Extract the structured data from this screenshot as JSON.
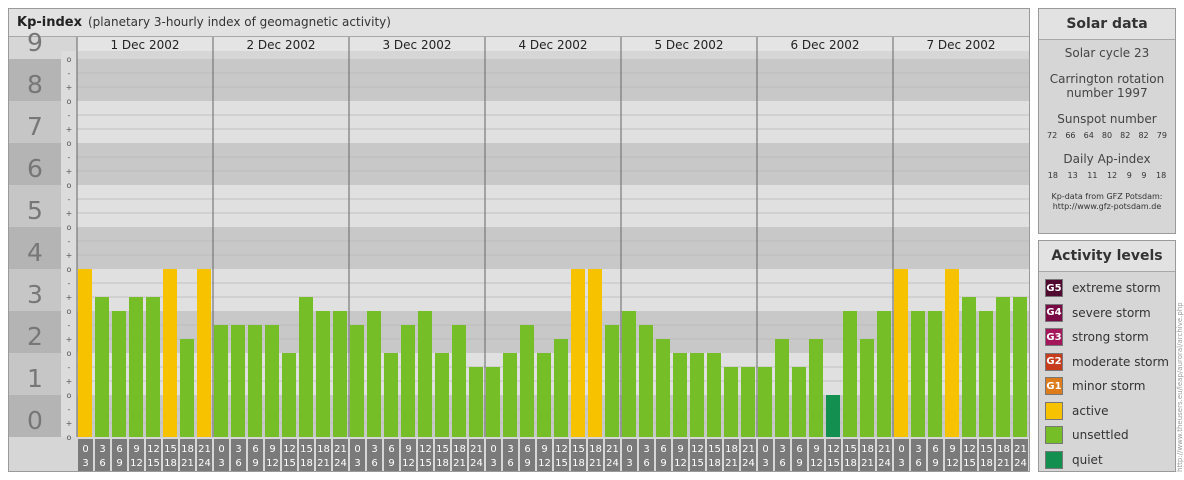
{
  "header": {
    "title": "Kp-index",
    "subtitle": "(planetary 3-hourly index of geomagnetic activity)"
  },
  "colors": {
    "active": "#f7c300",
    "unsettled": "#76be28",
    "quiet": "#13904f",
    "minor_storm": "#de7b1a",
    "moderate_storm": "#c83c1e",
    "strong_storm": "#a4175a",
    "severe_storm": "#7a0a45",
    "extreme_storm": "#50092f"
  },
  "chart_data": {
    "type": "bar",
    "title": "Kp-index",
    "subtitle": "(planetary 3-hourly index of geomagnetic activity)",
    "ylim": [
      0,
      9
    ],
    "y_tick_labels": [
      "0",
      "1",
      "2",
      "3",
      "4",
      "5",
      "6",
      "7",
      "8",
      "9"
    ],
    "y_minor_labels": [
      "o",
      "+",
      "-",
      "o",
      "+",
      "-",
      "o",
      "+",
      "-",
      "o",
      "+",
      "-",
      "o",
      "+",
      "-",
      "o",
      "+",
      "-",
      "o",
      "+",
      "-",
      "o",
      "+",
      "-",
      "o",
      "+",
      "-",
      "o"
    ],
    "days": [
      "1 Dec 2002",
      "2 Dec 2002",
      "3 Dec 2002",
      "4 Dec 2002",
      "5 Dec 2002",
      "6 Dec 2002",
      "7 Dec 2002"
    ],
    "interval_starts": [
      "0",
      "3",
      "6",
      "9",
      "12",
      "15",
      "18",
      "21"
    ],
    "interval_ends": [
      "3",
      "6",
      "9",
      "12",
      "15",
      "18",
      "21",
      "24"
    ],
    "values": [
      4.0,
      3.333,
      3.0,
      3.333,
      3.333,
      4.0,
      2.333,
      4.0,
      2.667,
      2.667,
      2.667,
      2.667,
      2.0,
      3.333,
      3.0,
      3.0,
      2.667,
      3.0,
      2.0,
      2.667,
      3.0,
      2.0,
      2.667,
      1.667,
      1.667,
      2.0,
      2.667,
      2.0,
      2.333,
      4.0,
      4.0,
      2.667,
      3.0,
      2.667,
      2.333,
      2.0,
      2.0,
      2.0,
      1.667,
      1.667,
      1.667,
      2.333,
      1.667,
      2.333,
      1.0,
      3.0,
      2.333,
      3.0,
      4.0,
      3.0,
      3.0,
      4.0,
      3.333,
      3.0,
      3.333,
      3.333
    ],
    "levels": [
      "active",
      "unsettled",
      "unsettled",
      "unsettled",
      "unsettled",
      "active",
      "unsettled",
      "active",
      "unsettled",
      "unsettled",
      "unsettled",
      "unsettled",
      "unsettled",
      "unsettled",
      "unsettled",
      "unsettled",
      "unsettled",
      "unsettled",
      "unsettled",
      "unsettled",
      "unsettled",
      "unsettled",
      "unsettled",
      "unsettled",
      "unsettled",
      "unsettled",
      "unsettled",
      "unsettled",
      "unsettled",
      "active",
      "active",
      "unsettled",
      "unsettled",
      "unsettled",
      "unsettled",
      "unsettled",
      "unsettled",
      "unsettled",
      "unsettled",
      "unsettled",
      "unsettled",
      "unsettled",
      "unsettled",
      "unsettled",
      "quiet",
      "unsettled",
      "unsettled",
      "unsettled",
      "active",
      "unsettled",
      "unsettled",
      "active",
      "unsettled",
      "unsettled",
      "unsettled",
      "unsettled"
    ]
  },
  "solar": {
    "title": "Solar data",
    "cycle": "Solar cycle 23",
    "carrington_line1": "Carrington rotation",
    "carrington_line2": "number 1997",
    "sunspot_label": "Sunspot number",
    "sunspot_values": [
      "72",
      "66",
      "64",
      "80",
      "82",
      "82",
      "79"
    ],
    "ap_label": "Daily Ap-index",
    "ap_values": [
      "18",
      "13",
      "11",
      "12",
      "9",
      "9",
      "18"
    ],
    "source_line1": "Kp-data from GFZ Potsdam:",
    "source_line2": "http://www.gfz-potsdam.de"
  },
  "activity": {
    "title": "Activity levels",
    "items": [
      {
        "code": "G5",
        "label": "extreme storm",
        "color": "#50092f"
      },
      {
        "code": "G4",
        "label": "severe storm",
        "color": "#7a0a45"
      },
      {
        "code": "G3",
        "label": "strong storm",
        "color": "#a4175a"
      },
      {
        "code": "G2",
        "label": "moderate storm",
        "color": "#c83c1e"
      },
      {
        "code": "G1",
        "label": "minor storm",
        "color": "#de7b1a"
      },
      {
        "code": "",
        "label": "active",
        "color": "#f7c300"
      },
      {
        "code": "",
        "label": "unsettled",
        "color": "#76be28"
      },
      {
        "code": "",
        "label": "quiet",
        "color": "#13904f"
      }
    ]
  },
  "watermark": "http://www.theusers.eu/leap/auroral/archive.php"
}
